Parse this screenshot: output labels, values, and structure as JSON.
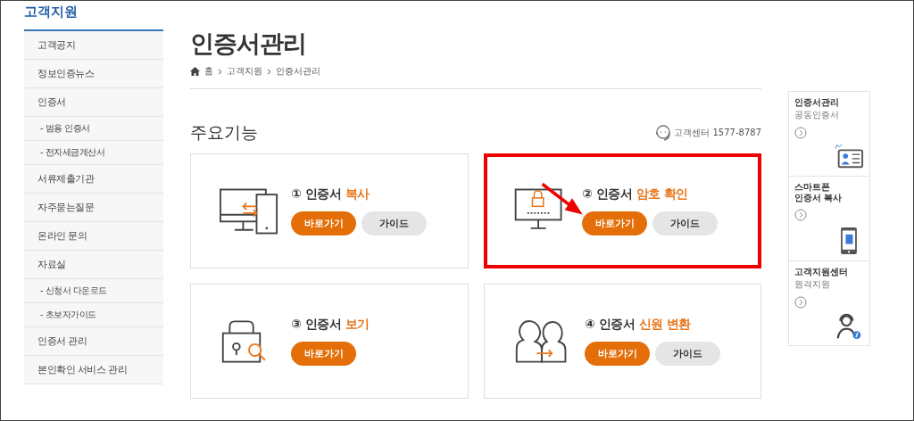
{
  "sidebar": {
    "title": "고객지원",
    "items": [
      {
        "label": "고객공지",
        "kind": "main"
      },
      {
        "label": "정보인증뉴스",
        "kind": "main"
      },
      {
        "label": "인증서",
        "kind": "main"
      },
      {
        "label": "- 범용 인증서",
        "kind": "sub"
      },
      {
        "label": "- 전자세금계산서",
        "kind": "sub"
      },
      {
        "label": "서류제출기관",
        "kind": "main"
      },
      {
        "label": "자주묻는질문",
        "kind": "main"
      },
      {
        "label": "온라인 문의",
        "kind": "main"
      },
      {
        "label": "자료실",
        "kind": "main"
      },
      {
        "label": "- 신청서 다운로드",
        "kind": "sub"
      },
      {
        "label": "- 초보자가이드",
        "kind": "sub"
      },
      {
        "label": "인증서 관리",
        "kind": "main"
      },
      {
        "label": "본인확인 서비스 관리",
        "kind": "main"
      }
    ]
  },
  "page": {
    "title": "인증서관리",
    "breadcrumb": [
      "홈",
      "고객지원",
      "인증서관리"
    ]
  },
  "section": {
    "title": "주요기능",
    "support": "고객센터 1577-8787"
  },
  "cards": [
    {
      "kind": "copy",
      "title": "① 인증서 ",
      "highlight": "복사",
      "go": "바로가기",
      "guide": "가이드",
      "marked": false
    },
    {
      "kind": "password",
      "title": "② 인증서 ",
      "highlight": "암호 확인",
      "go": "바로가기",
      "guide": "가이드",
      "marked": true
    },
    {
      "kind": "view",
      "title": "③ 인증서 ",
      "highlight": "보기",
      "go": "바로가기",
      "marked": false
    },
    {
      "kind": "convert",
      "title": "④ 인증서 ",
      "highlight": "신원 변환",
      "go": "바로가기",
      "guide": "가이드",
      "marked": false
    }
  ],
  "quick_links": [
    {
      "kind": "id",
      "title": "인증서관리",
      "subtitle": "공동인증서"
    },
    {
      "kind": "phone",
      "title": "스마트폰\n인증서 복사"
    },
    {
      "kind": "agent",
      "title": "고객지원센터",
      "subtitle": "원격지원"
    }
  ]
}
